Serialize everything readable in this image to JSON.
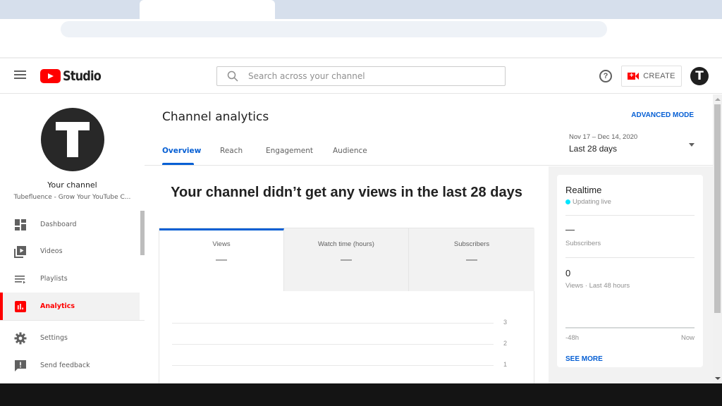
{
  "browser": {
    "search_placeholder": "Search across your channel"
  },
  "header": {
    "logo_text": "Studio",
    "help_symbol": "?",
    "create_label": "CREATE",
    "create_icon_symbol": "+",
    "account_initial": "T"
  },
  "sidebar": {
    "channel_title": "Your channel",
    "channel_name": "Tubefluence - Grow Your YouTube C...",
    "items": [
      {
        "label": "Dashboard",
        "icon": "dashboard-icon",
        "active": false
      },
      {
        "label": "Videos",
        "icon": "videos-icon",
        "active": false
      },
      {
        "label": "Playlists",
        "icon": "playlists-icon",
        "active": false
      },
      {
        "label": "Analytics",
        "icon": "analytics-icon",
        "active": true
      },
      {
        "label": "Settings",
        "icon": "gear-icon",
        "active": false
      },
      {
        "label": "Send feedback",
        "icon": "feedback-icon",
        "active": false
      }
    ]
  },
  "main": {
    "title": "Channel analytics",
    "advanced_mode": "ADVANCED MODE",
    "tabs": [
      {
        "label": "Overview",
        "active": true
      },
      {
        "label": "Reach",
        "active": false
      },
      {
        "label": "Engagement",
        "active": false
      },
      {
        "label": "Audience",
        "active": false
      }
    ],
    "date_range": {
      "dates": "Nov 17 – Dec 14, 2020",
      "period": "Last 28 days"
    },
    "headline": "Your channel didn’t get any views in the last 28 days",
    "metrics": [
      {
        "label": "Views",
        "value": "—",
        "active": true
      },
      {
        "label": "Watch time (hours)",
        "value": "—",
        "active": false
      },
      {
        "label": "Subscribers",
        "value": "—",
        "active": false
      }
    ],
    "chart_y_ticks": [
      "3",
      "2",
      "1"
    ]
  },
  "realtime": {
    "title": "Realtime",
    "status": "Updating live",
    "subscribers_value": "—",
    "subscribers_label": "Subscribers",
    "views_value": "0",
    "views_label": "Views · Last 48 hours",
    "x_start": "-48h",
    "x_end": "Now",
    "see_more": "SEE MORE"
  },
  "colors": {
    "brand_red": "#ff0000",
    "accent_blue": "#065fd4",
    "live_cyan": "#00e5ff"
  }
}
